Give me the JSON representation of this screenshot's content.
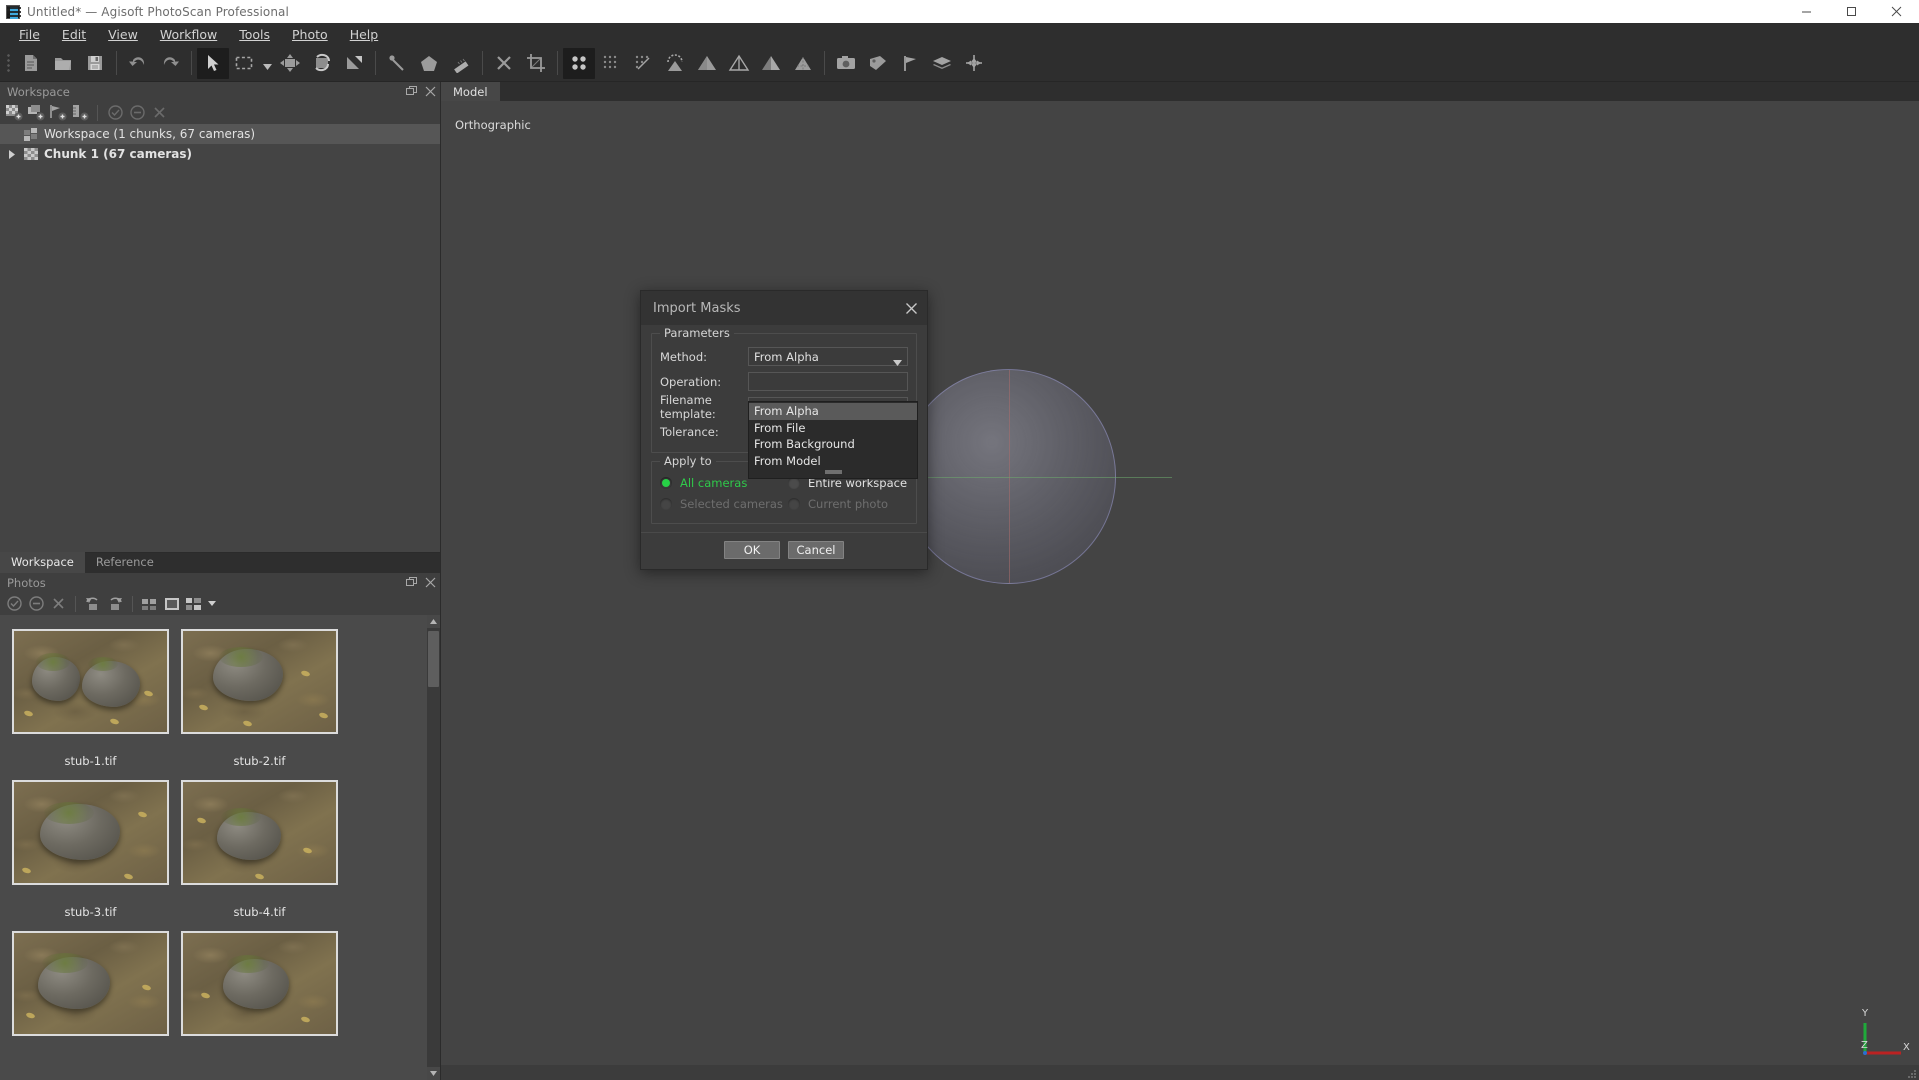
{
  "window": {
    "title": "Untitled* — Agisoft PhotoScan Professional",
    "app_icon": "film-strip-icon",
    "controls": {
      "minimize": "minimize-icon",
      "maximize": "maximize-icon",
      "close": "close-icon"
    }
  },
  "menubar": {
    "items": [
      {
        "label": "File",
        "mnemonic": "F"
      },
      {
        "label": "Edit",
        "mnemonic": "E"
      },
      {
        "label": "View",
        "mnemonic": "V"
      },
      {
        "label": "Workflow",
        "mnemonic": "W"
      },
      {
        "label": "Tools",
        "mnemonic": "T"
      },
      {
        "label": "Photo",
        "mnemonic": "P"
      },
      {
        "label": "Help",
        "mnemonic": "H"
      }
    ]
  },
  "toolbar": {
    "groups": [
      [
        "new-project-icon",
        "open-project-icon",
        "save-project-icon"
      ],
      [
        "undo-icon",
        "redo-icon"
      ],
      [
        "navigation-arrow-icon",
        "rectangle-selection-icon",
        "selection-dropdown-caret-icon",
        "move-object-icon",
        "rotate-object-icon",
        "scale-object-icon"
      ],
      [
        "resize-region-icon",
        "rotate-region-icon",
        "reset-region-icon"
      ],
      [
        "delete-selection-icon",
        "crop-selection-icon"
      ],
      [
        "point-cloud-icon",
        "dense-cloud-icon",
        "classified-cloud-icon",
        "mesh-shaded-icon",
        "mesh-solid-icon",
        "mesh-wireframe-icon",
        "mesh-confidence-icon",
        "mesh-textured-icon"
      ],
      [
        "camera-icon",
        "photo-align-icon",
        "marker-flag-icon",
        "layers-icon",
        "reset-view-icon"
      ]
    ],
    "active": "navigation-arrow-icon"
  },
  "workspace_panel": {
    "title": "Workspace",
    "title_buttons": [
      "undock-icon",
      "close-icon"
    ],
    "toolbar_icons": [
      "add-chunk-icon",
      "add-photos-icon",
      "add-markers-icon",
      "add-scalebar-icon",
      "enable-icon",
      "disable-icon",
      "remove-icon"
    ],
    "tree": [
      {
        "label": "Workspace (1 chunks, 67 cameras)",
        "icon": "workspace-icon",
        "selected": true,
        "expandable": false,
        "bold": false
      },
      {
        "label": "Chunk 1 (67 cameras)",
        "icon": "chunk-icon",
        "selected": false,
        "expandable": true,
        "bold": true
      }
    ]
  },
  "bottom_tabs": [
    {
      "label": "Workspace",
      "active": true
    },
    {
      "label": "Reference",
      "active": false
    }
  ],
  "photos_panel": {
    "title": "Photos",
    "title_buttons": [
      "undock-icon",
      "close-icon"
    ],
    "toolbar_icons": [
      "enable-icon",
      "disable-icon",
      "remove-icon",
      "rotate-left-icon",
      "rotate-right-icon",
      "compare-icon",
      "photo-single-icon",
      "thumbnail-size-icon",
      "thumbnail-dropdown-caret-icon"
    ],
    "thumbnails": [
      {
        "label": "stub-1.tif"
      },
      {
        "label": "stub-2.tif"
      },
      {
        "label": "stub-3.tif"
      },
      {
        "label": "stub-4.tif"
      },
      {
        "label": ""
      },
      {
        "label": ""
      }
    ],
    "scrollbar": {
      "up_arrow": "scroll-up-icon",
      "down_arrow": "scroll-down-icon"
    }
  },
  "model_view": {
    "tab": "Model",
    "projection_label": "Orthographic",
    "axis_gizmo": {
      "x_label": "X",
      "y_label": "Y",
      "z_label": "Z",
      "x_color": "#bb2222",
      "y_color": "#1faa3a",
      "z_color": "#2a6fd0"
    }
  },
  "dialog": {
    "title": "Import Masks",
    "close_icon": "close-icon",
    "parameters": {
      "legend": "Parameters",
      "fields": [
        {
          "label": "Method:",
          "type": "combobox",
          "value": "From Alpha"
        },
        {
          "label": "Operation:",
          "type": "combobox",
          "value": ""
        },
        {
          "label": "Filename template:",
          "type": "text",
          "value": ""
        },
        {
          "label": "Tolerance:",
          "type": "spinbox",
          "value": ""
        }
      ]
    },
    "dropdown": {
      "open": true,
      "highlighted": "From Alpha",
      "options": [
        "From Alpha",
        "From File",
        "From Background",
        "From Model"
      ]
    },
    "apply_to": {
      "legend": "Apply to",
      "options": [
        {
          "label": "All cameras",
          "selected": true,
          "enabled": true
        },
        {
          "label": "Entire workspace",
          "selected": false,
          "enabled": true
        },
        {
          "label": "Selected cameras",
          "selected": false,
          "enabled": false
        },
        {
          "label": "Current photo",
          "selected": false,
          "enabled": false
        }
      ]
    },
    "buttons": [
      {
        "label": "OK"
      },
      {
        "label": "Cancel"
      }
    ]
  },
  "colors": {
    "accent_green": "#27d046",
    "window_bg": "#444444",
    "panel_bg": "#3f3f3f",
    "dialog_bg": "#3c3c3c"
  }
}
